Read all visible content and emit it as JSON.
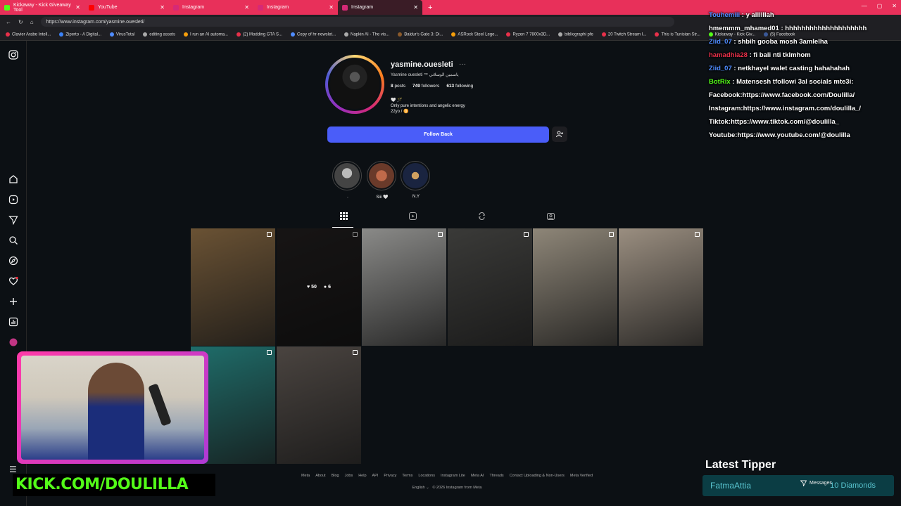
{
  "browser": {
    "tabs": [
      {
        "label": "Kickaway - Kick Giveaway Tool",
        "color": "#53fc18",
        "active": false
      },
      {
        "label": "YouTube",
        "color": "#ff0000",
        "active": false
      },
      {
        "label": "Instagram",
        "color": "#d62976",
        "active": false
      },
      {
        "label": "Instagram",
        "color": "#d62976",
        "active": false
      },
      {
        "label": "Instagram",
        "color": "#d62976",
        "active": true
      }
    ],
    "url": "https://www.instagram.com/yasmine.ouesleti/",
    "bookmarks": [
      "Clavier Arabe Intell...",
      "Ziperto - A Digital...",
      "VirusTotal",
      "editing assets",
      "I run an AI automa...",
      "(2) Modding GTA S...",
      "Copy of hr-newslet...",
      "Napkin AI - The vis...",
      "Baldur's Gate 3: Di...",
      "ASRock Steel Lege...",
      "Ryzen 7 7800x3D...",
      "bibliographi pfe",
      "20 Twitch Stream I...",
      "This is Tunisian Str...",
      "Kickaway - Kick Giv...",
      "(5) Facebook"
    ]
  },
  "profile": {
    "username": "yasmine.ouesleti",
    "more": "···",
    "full_name": "Yasmine ouesleti ™ ياسمين الوسلاتي",
    "posts": "8",
    "posts_label": "posts",
    "followers": "749",
    "followers_label": "followers",
    "following": "613",
    "following_label": "following",
    "bio_line1": "🤍 🪄",
    "bio_line2": "Only pure intentions and angelic energy",
    "bio_line3": "22yo / ♊",
    "follow_label": "Follow Back"
  },
  "highlights": [
    {
      "label": "."
    },
    {
      "label": "Siii 🤍"
    },
    {
      "label": "N.Y"
    }
  ],
  "posts_grid": [
    {
      "bg": "#6a5234",
      "overlay": false
    },
    {
      "bg": "#2a2626",
      "overlay": true,
      "likes": "50",
      "comments": "6"
    },
    {
      "bg": "#8a8a88",
      "overlay": false
    },
    {
      "bg": "#3a3a38",
      "overlay": false
    },
    {
      "bg": "#8e8678",
      "overlay": false
    },
    {
      "bg": "#9a8e80",
      "overlay": false
    },
    {
      "bg": "#1f6d6a",
      "overlay": false
    },
    {
      "bg": "#4a4440",
      "overlay": false
    }
  ],
  "footer": {
    "links": [
      "Meta",
      "About",
      "Blog",
      "Jobs",
      "Help",
      "API",
      "Privacy",
      "Terms",
      "Locations",
      "Instagram Lite",
      "Meta AI",
      "Threads",
      "Contact Uploading & Non-Users",
      "Meta Verified"
    ],
    "language": "English ⌄",
    "copyright": "© 2026 Instagram from Meta"
  },
  "chat": [
    {
      "user": "Touhemiii",
      "color": "#4f8cff",
      "msg": ": y allllllah"
    },
    {
      "user": "hmemmm_mhamed01",
      "color": "#ffffff",
      "msg": ": hhhhhhhhhhhhhhhhhhhh"
    },
    {
      "user": "Ziid_07",
      "color": "#4f8cff",
      "msg": ": shbih gooba mosh 3amlelha"
    },
    {
      "user": "hamadhia28",
      "color": "#e8304a",
      "msg": ": fi bali nti tklmhom"
    },
    {
      "user": "Ziid_07",
      "color": "#4f8cff",
      "msg": ": netkhayel walet casting hahahahah"
    },
    {
      "user": "BotRix",
      "color": "#53fc18",
      "msg": ": Matensesh tfollowi 3al socials mte3i:"
    },
    {
      "user": "",
      "color": "#ffffff",
      "msg": "Facebook:https://www.facebook.com/Doulilla/"
    },
    {
      "user": "",
      "color": "#ffffff",
      "msg": "Instagram:https://www.instagram.com/doulilla_/"
    },
    {
      "user": "",
      "color": "#ffffff",
      "msg": "Tiktok:https://www.tiktok.com/@doulilla_"
    },
    {
      "user": "",
      "color": "#ffffff",
      "msg": "Youtube:https://www.youtube.com/@doulilla"
    }
  ],
  "stream": {
    "kick_banner": "KICK.COM/DOULILLA",
    "tipper_title": "Latest Tipper",
    "tipper_name": "FatmaAttia",
    "tipper_amount": "10 Diamonds",
    "messages_label": "Messages"
  }
}
